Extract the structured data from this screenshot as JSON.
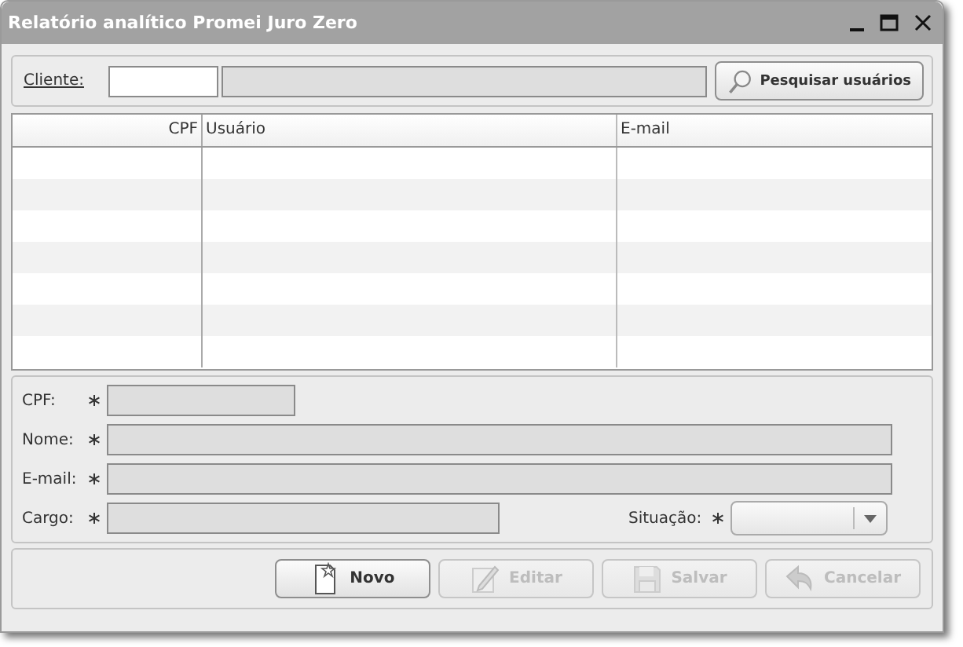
{
  "window": {
    "title": "Relatório analítico Promei Juro Zero"
  },
  "client": {
    "label": "Cliente:",
    "search_button": "Pesquisar usuários"
  },
  "table": {
    "columns": [
      {
        "label": "CPF",
        "kind": "numeric"
      },
      {
        "label": "Usuário",
        "kind": "text"
      },
      {
        "label": "E-mail",
        "kind": "text"
      }
    ]
  },
  "form": {
    "rows": [
      [
        {
          "label": "CPF:",
          "required": true,
          "kind": "short"
        }
      ],
      [
        {
          "label": "Nome:",
          "required": true,
          "kind": "wide"
        }
      ],
      [
        {
          "label": "E-mail:",
          "required": true,
          "kind": "wide"
        }
      ],
      [
        {
          "label": "Cargo:",
          "required": true,
          "kind": "medium"
        },
        {
          "label": "Situação:",
          "required": true,
          "kind": "select"
        }
      ]
    ]
  },
  "buttons": [
    {
      "label": "Novo",
      "kind": "new",
      "disabled": false
    },
    {
      "label": "Editar",
      "kind": "edit",
      "disabled": true
    },
    {
      "label": "Salvar",
      "kind": "save",
      "disabled": true
    },
    {
      "label": "Cancelar",
      "kind": "undo",
      "disabled": true
    }
  ]
}
